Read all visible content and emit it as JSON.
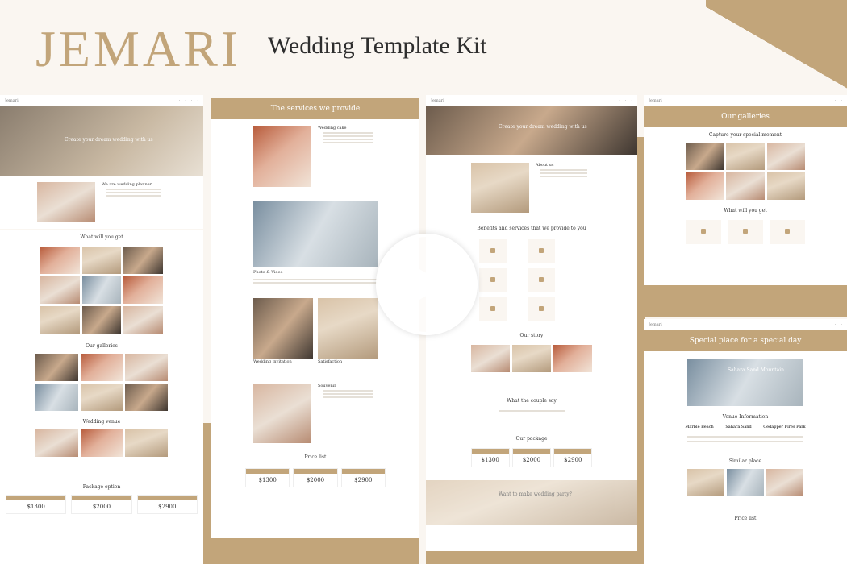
{
  "brand": "JEMARI",
  "tagline": "Wedding Template Kit",
  "colors": {
    "accent": "#c2a57a",
    "background": "#faf6f1",
    "dark": "#2e2e2e"
  },
  "nav": {
    "logo": "Jemari"
  },
  "col1": {
    "hero": "Create your dream wedding with us",
    "about_title": "We are wedding planner",
    "what_title": "What will you get",
    "gallery_title": "Our galleries",
    "venue_title": "Wedding venue",
    "package_title": "Package option",
    "prices": [
      "$1300",
      "$2000",
      "$2900"
    ]
  },
  "col2": {
    "services_title": "The services we provide",
    "item1": "Wedding cake",
    "item2": "Photo & Video",
    "item3": "Wedding invitation",
    "item4": "Satisfaction",
    "item5": "Souvenir",
    "price_title": "Price list",
    "prices": [
      "$1300",
      "$2000",
      "$2900"
    ]
  },
  "col3": {
    "hero": "Create your dream wedding with us",
    "about": "About us",
    "benefits": "Benefits and services that we provide to you",
    "story": "Our story",
    "couple": "What the couple say",
    "package": "Our package",
    "prices": [
      "$1300",
      "$2000",
      "$2900"
    ],
    "cta": "Want to make wedding party?"
  },
  "col4": {
    "gallery_title": "Our galleries",
    "capture": "Capture your special moment",
    "what_title": "What will you get",
    "special": "Special place for a special day",
    "venue_name": "Sahara Sand Mountain",
    "venue_info": "Venue Information",
    "venues": [
      "Marble Beach",
      "Sahara Sand",
      "Cedapper Fires Park"
    ],
    "similar": "Similar place",
    "price": "Price list"
  },
  "play_label": "Play video"
}
